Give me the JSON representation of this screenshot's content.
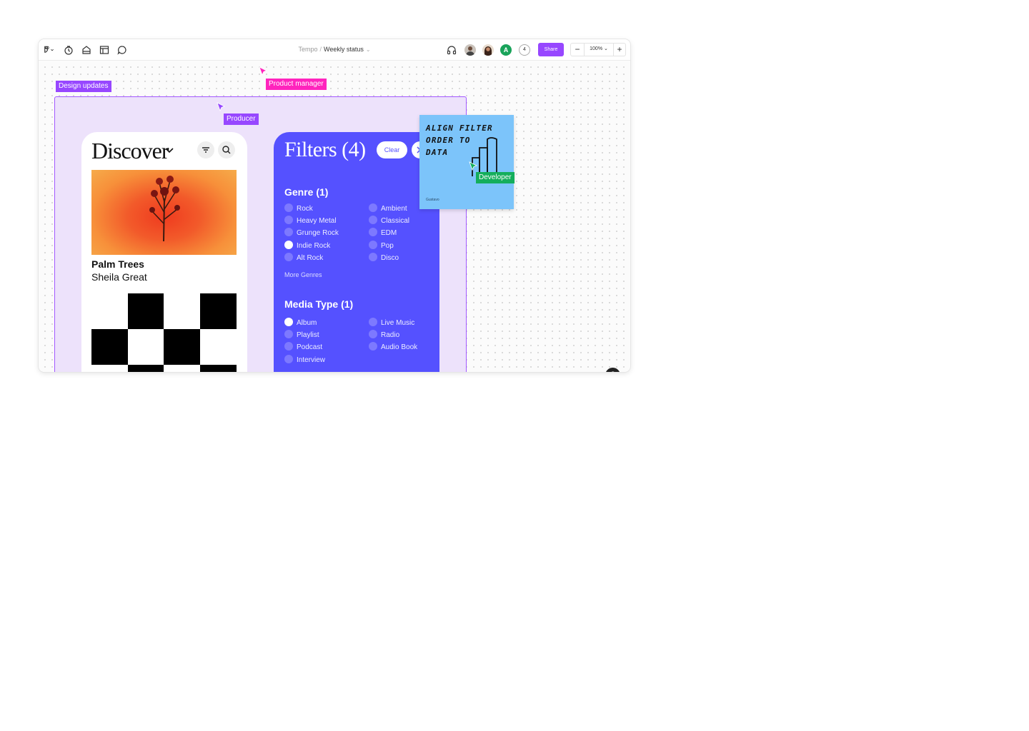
{
  "toolbar": {
    "breadcrumb_project": "Tempo",
    "breadcrumb_separator": "/",
    "document_title": "Weekly status",
    "collaborator_count": "4",
    "avatar_initial": "A",
    "share_label": "Share",
    "zoom_minus": "−",
    "zoom_level": "100%",
    "zoom_plus": "+",
    "icons": [
      "figma-menu-icon",
      "clock-icon",
      "asset-icon",
      "layout-icon",
      "comment-icon",
      "headphones-icon"
    ]
  },
  "canvas": {
    "frame_label": "Design updates",
    "cursors": [
      {
        "name": "Product manager",
        "color": "#ff24bd"
      },
      {
        "name": "Producer",
        "color": "#9747ff"
      },
      {
        "name": "Developer",
        "color": "#14ae5c"
      }
    ],
    "help_label": "?"
  },
  "discover": {
    "title": "Discover",
    "track_title": "Palm Trees",
    "track_artist": "Sheila Great"
  },
  "filters": {
    "title": "Filters (4)",
    "clear_label": "Clear",
    "genre_heading": "Genre (1)",
    "genres_left": [
      {
        "label": "Rock",
        "selected": false
      },
      {
        "label": "Heavy Metal",
        "selected": false
      },
      {
        "label": "Grunge Rock",
        "selected": false
      },
      {
        "label": "Indie Rock",
        "selected": true
      },
      {
        "label": "Alt Rock",
        "selected": false
      }
    ],
    "genres_right": [
      {
        "label": "Ambient",
        "selected": false
      },
      {
        "label": "Classical",
        "selected": false
      },
      {
        "label": "EDM",
        "selected": false
      },
      {
        "label": "Pop",
        "selected": false
      },
      {
        "label": "Disco",
        "selected": false
      }
    ],
    "more_genres": "More Genres",
    "media_heading": "Media Type (1)",
    "media_left": [
      {
        "label": "Album",
        "selected": true
      },
      {
        "label": "Playlist",
        "selected": false
      },
      {
        "label": "Podcast",
        "selected": false
      },
      {
        "label": "Interview",
        "selected": false
      }
    ],
    "media_right": [
      {
        "label": "Live Music",
        "selected": false
      },
      {
        "label": "Radio",
        "selected": false
      },
      {
        "label": "Audio Book",
        "selected": false
      }
    ]
  },
  "sticky_note": {
    "lines": [
      "ALIGN FILTER",
      "ORDER TO",
      "DATA"
    ],
    "author": "Gustavo",
    "color": "#7cc4fa"
  },
  "colors": {
    "accent_purple": "#9747ff",
    "filters_blue": "#5551ff",
    "frame_fill": "#ede2fb"
  }
}
